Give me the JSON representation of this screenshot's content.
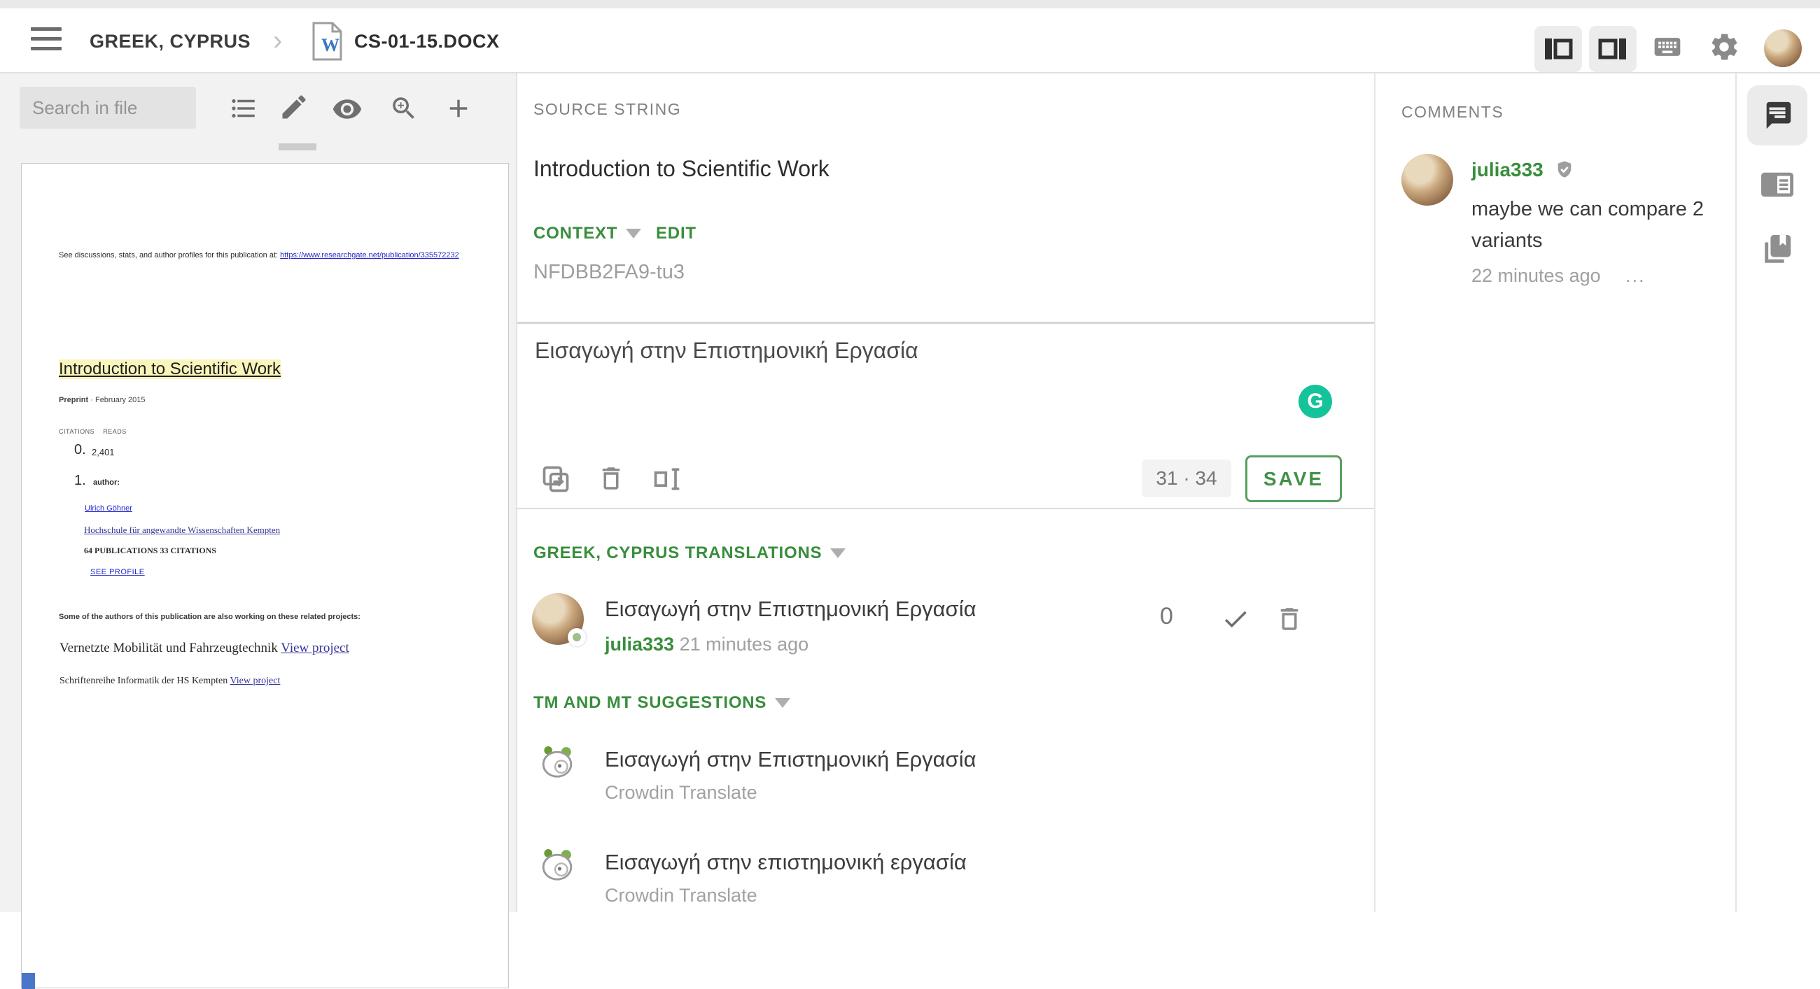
{
  "header": {
    "breadcrumb_project": "GREEK, CYPRUS",
    "breadcrumb_separator": "›",
    "file_name": "CS-01-15.DOCX"
  },
  "left_panel": {
    "search_placeholder": "Search in file",
    "document": {
      "see_line": "See discussions, stats, and author profiles for this publication at:",
      "see_link": "https://www.researchgate.net/publication/335572232",
      "title": "Introduction to Scientific Work",
      "preprint_label": "Preprint",
      "preprint_date": "· February 2015",
      "citations_label": "CITATIONS",
      "reads_label": "READS",
      "list_num_0": "0.",
      "reads_value": "2,401",
      "list_num_1": "1.",
      "author_label": "author:",
      "author_name": "Ulrich Göhner",
      "author_affiliation": "Hochschule für angewandte Wissenschaften Kempten",
      "author_stats": "64 PUBLICATIONS 33 CITATIONS",
      "see_profile": "SEE PROFILE",
      "related_intro": "Some of the authors of this publication are also working on these related projects:",
      "project1_title": "Vernetzte Mobilität und Fahrzeugtechnik",
      "project1_link": "View project",
      "project2_title": "Schriftenreihe Informatik der HS Kempten",
      "project2_link": "View project"
    }
  },
  "source_panel": {
    "header": "SOURCE STRING",
    "source_text": "Introduction to Scientific Work",
    "context_label": "CONTEXT",
    "edit_label": "EDIT",
    "context_value": "NFDBB2FA9-tu3",
    "translation_text": "Εισαγωγή στην Επιστημονική Εργασία",
    "grammarly_letter": "G",
    "char_counter": "31 · 34",
    "save_label": "SAVE"
  },
  "translations_section": {
    "header": "GREEK, CYPRUS TRANSLATIONS",
    "items": [
      {
        "text": "Εισαγωγή στην Επιστημονική Εργασία",
        "author": "julia333",
        "time": "21 minutes ago",
        "votes": "0"
      }
    ]
  },
  "suggestions_section": {
    "header": "TM AND MT SUGGESTIONS",
    "items": [
      {
        "text": "Εισαγωγή στην Επιστημονική Εργασία",
        "source": "Crowdin Translate"
      },
      {
        "text": "Εισαγωγή στην επιστημονική εργασία",
        "source": "Crowdin Translate"
      }
    ]
  },
  "comments_panel": {
    "header": "COMMENTS",
    "comments": [
      {
        "author": "julia333",
        "text": "maybe we can compare 2 variants",
        "time": "22 minutes ago",
        "more": "..."
      }
    ]
  },
  "colors": {
    "accent_green": "#388e3c",
    "save_green": "#57a05f",
    "grammarly_green": "#15c39a"
  }
}
